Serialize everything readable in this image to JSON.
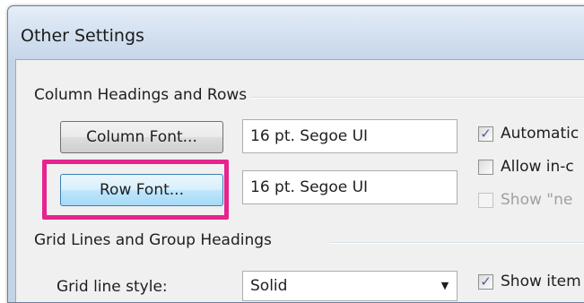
{
  "dialog": {
    "title": "Other Settings"
  },
  "column_headings_group": {
    "label": "Column Headings and Rows",
    "column_font_button": "Column Font...",
    "column_font_value": "16 pt. Segoe UI",
    "row_font_button": "Row Font...",
    "row_font_value": "16 pt. Segoe UI",
    "automatic_label": "Automatic",
    "automatic_checked": true,
    "allow_label": "Allow in-c",
    "allow_checked": false,
    "show_new_label": "Show \"ne",
    "show_new_enabled": false
  },
  "grid_lines_group": {
    "label": "Grid Lines and Group Headings",
    "grid_style_label": "Grid line style:",
    "grid_style_value": "Solid",
    "show_items_label": "Show item",
    "show_items_checked": true
  },
  "icons": {
    "check": "✓",
    "dropdown": "▼"
  },
  "colors": {
    "highlight": "#e6238e",
    "focus_border": "#3c7fb1"
  }
}
